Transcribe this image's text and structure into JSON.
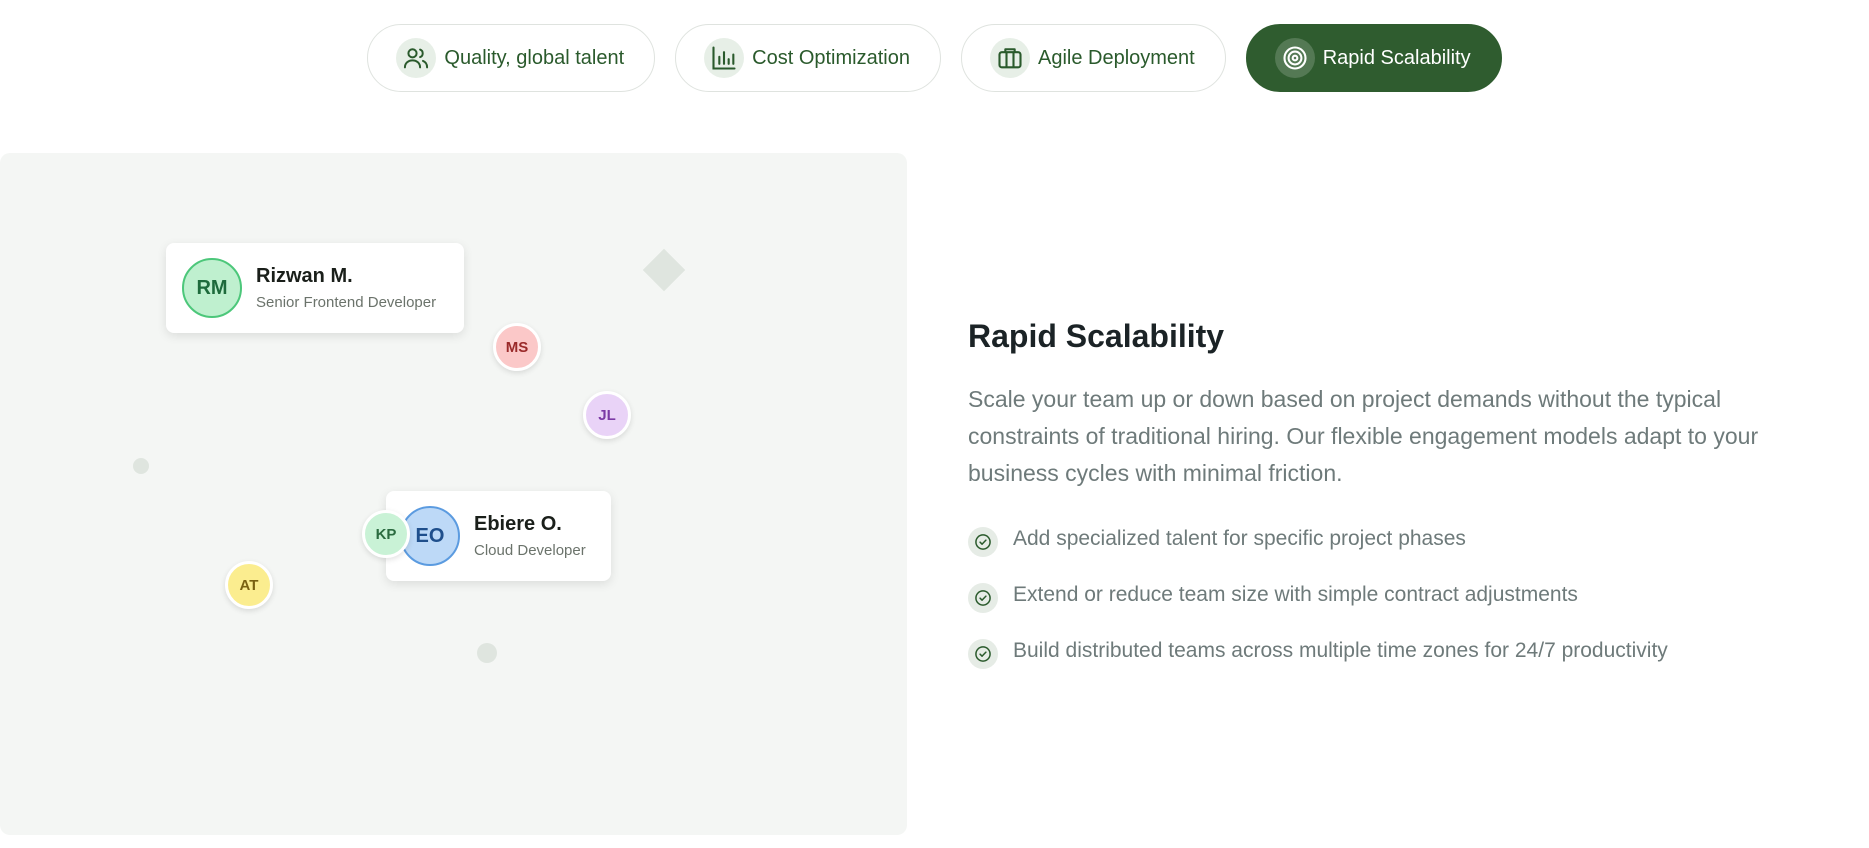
{
  "tabs": [
    {
      "label": "Quality, global talent",
      "icon": "users-icon",
      "active": false
    },
    {
      "label": "Cost Optimization",
      "icon": "bar-chart-icon",
      "active": false
    },
    {
      "label": "Agile Deployment",
      "icon": "briefcase-icon",
      "active": false
    },
    {
      "label": "Rapid Scalability",
      "icon": "target-icon",
      "active": true
    }
  ],
  "illustration": {
    "cards": [
      {
        "initials": "RM",
        "name": "Rizwan M.",
        "role": "Senior Frontend Developer",
        "avatar_bg": "#bff0cf",
        "avatar_border": "#4cc77a",
        "avatar_text": "#1e6b3c"
      },
      {
        "initials": "EO",
        "name": "Ebiere O.",
        "role": "Cloud Developer",
        "avatar_bg": "#bdd9f7",
        "avatar_border": "#5b9be0",
        "avatar_text": "#1f4f8c"
      }
    ],
    "bubbles": [
      {
        "initials": "MS",
        "bg": "#fbc8c8",
        "text": "#9a2a2a"
      },
      {
        "initials": "JL",
        "bg": "#e9d3f7",
        "text": "#7b3aa5"
      },
      {
        "initials": "KP",
        "bg": "#c9f2d6",
        "text": "#2b6b40"
      },
      {
        "initials": "AT",
        "bg": "#fbed8f",
        "text": "#7a6212"
      }
    ]
  },
  "content": {
    "title": "Rapid Scalability",
    "description": "Scale your team up or down based on project demands without the typical constraints of traditional hiring. Our flexible engagement models adapt to your business cycles with minimal friction.",
    "features": [
      "Add specialized talent for specific project phases",
      "Extend or reduce team size with simple contract adjustments",
      "Build distributed teams across multiple time zones for 24/7 productivity"
    ]
  },
  "colors": {
    "brand_green": "#2f5c2f",
    "panel_bg": "#f4f6f4",
    "text_muted": "#6e7a7a",
    "heading": "#1b2326"
  }
}
